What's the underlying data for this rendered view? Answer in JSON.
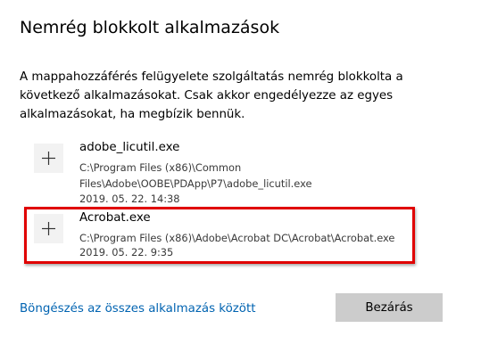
{
  "dialog": {
    "title": "Nemrég blokkolt alkalmazások",
    "description": "A mappahozzáférés felügyelete szolgáltatás nemrég blokkolta a következő alkalmazásokat. Csak akkor engedélyezze az egyes alkalmazásokat, ha megbízik bennük."
  },
  "apps": [
    {
      "name": "adobe_licutil.exe",
      "path": "C:\\Program Files (x86)\\Common Files\\Adobe\\OOBE\\PDApp\\P7\\adobe_licutil.exe",
      "date": "2019. 05. 22. 14:38",
      "icon": "plus-icon"
    },
    {
      "name": "Acrobat.exe",
      "path": "C:\\Program Files (x86)\\Adobe\\Acrobat DC\\Acrobat\\Acrobat.exe",
      "date": "2019. 05. 22. 9:35",
      "icon": "plus-icon"
    }
  ],
  "footer": {
    "browse_link": "Böngészés az összes alkalmazás között",
    "close_label": "Bezárás"
  },
  "colors": {
    "highlight": "#e00000",
    "link": "#0063b1",
    "button_bg": "#cccccc",
    "tile_bg": "#f2f2f2"
  }
}
